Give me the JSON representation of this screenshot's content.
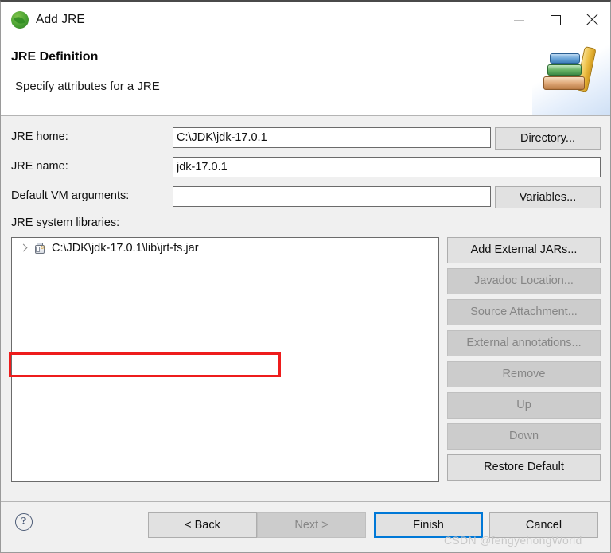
{
  "window": {
    "title": "Add JRE",
    "app_icon": "jre-icon",
    "controls": {
      "minimize": "minimize-icon",
      "maximize": "maximize-icon",
      "close": "close-icon"
    }
  },
  "header": {
    "title": "JRE Definition",
    "subtitle": "Specify attributes for a JRE",
    "art": "books-stack-image"
  },
  "form": {
    "jre_home": {
      "label": "JRE home:",
      "value": "C:\\JDK\\jdk-17.0.1",
      "placeholder": "",
      "button": "Directory..."
    },
    "jre_name": {
      "label": "JRE name:",
      "value": "jdk-17.0.1",
      "placeholder": ""
    },
    "vm_args": {
      "label": "Default VM arguments:",
      "value": "",
      "placeholder": "",
      "button": "Variables..."
    }
  },
  "libraries": {
    "label": "JRE system libraries:",
    "items": [
      {
        "text": "C:\\JDK\\jdk-17.0.1\\lib\\jrt-fs.jar",
        "expandable": true,
        "icon": "jar-icon"
      }
    ],
    "buttons": [
      {
        "label": "Add External JARs...",
        "enabled": true
      },
      {
        "label": "Javadoc Location...",
        "enabled": false
      },
      {
        "label": "Source Attachment...",
        "enabled": false
      },
      {
        "label": "External annotations...",
        "enabled": false
      },
      {
        "label": "Remove",
        "enabled": false
      },
      {
        "label": "Up",
        "enabled": false
      },
      {
        "label": "Down",
        "enabled": false
      },
      {
        "label": "Restore Default",
        "enabled": true
      }
    ],
    "annotation_color": "#ee1c1c"
  },
  "footer": {
    "help": "?",
    "buttons": [
      {
        "label": "< Back",
        "enabled": true,
        "primary": false
      },
      {
        "label": "Next >",
        "enabled": false,
        "primary": false
      },
      {
        "label": "Finish",
        "enabled": true,
        "primary": true
      },
      {
        "label": "Cancel",
        "enabled": true,
        "primary": false
      }
    ]
  },
  "watermark": "CSDN @fengyehongWorld",
  "colors": {
    "accent": "#0078d7",
    "annotation": "#ee1c1c",
    "dialog_bg": "#f0f0f0"
  }
}
